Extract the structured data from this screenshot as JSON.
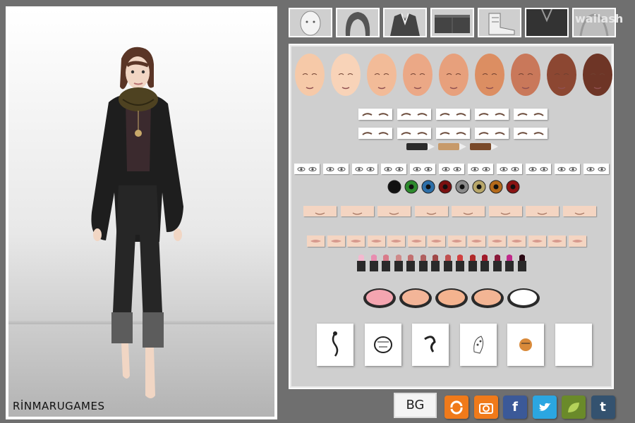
{
  "branding": {
    "studio_label": "RİNMARUGAMES",
    "watermark": "wailash"
  },
  "category_tabs": [
    {
      "icon": "face-base-icon"
    },
    {
      "icon": "hair-icon"
    },
    {
      "icon": "top-icon"
    },
    {
      "icon": "bottom-icon"
    },
    {
      "icon": "shoe-icon"
    },
    {
      "icon": "jacket-icon"
    },
    {
      "icon": "accessory-icon"
    }
  ],
  "skin_tones": [
    "#f6c9a8",
    "#f8d3b8",
    "#f2bb98",
    "#eba886",
    "#e7a07c",
    "#dc8e62",
    "#c9785a",
    "#8c4732",
    "#6e3526"
  ],
  "eye_shadow_colors": [
    "#2b2b2b",
    "#c79a6a",
    "#7a4a2a"
  ],
  "eye_colors": [
    "#111111",
    "#2d8a2d",
    "#2d6fa8",
    "#7a1010",
    "#8a8a8a",
    "#b8a76a",
    "#b56a1a",
    "#8a1414"
  ],
  "lipstick_colors": [
    "#f3b9cf",
    "#e88db0",
    "#d97b8a",
    "#cf8a8a",
    "#c27070",
    "#b06060",
    "#a04848",
    "#c05050",
    "#d04040",
    "#b02a2a",
    "#a01a2a",
    "#8a1a3a",
    "#c02a8a",
    "#2a0a14"
  ],
  "blush_colors": [
    "#f4a5b0",
    "#f3b598",
    "#f4b38f",
    "#f3b594",
    "#ffffff"
  ],
  "tattoos": [
    "scorpion-tattoo-icon",
    "tiger-face-tattoo-icon",
    "dragon-tattoo-icon",
    "leopard-tattoo-icon",
    "tiger-color-tattoo-icon",
    "empty-tattoo-slot"
  ],
  "bottom_bar": {
    "bg_label": "BG",
    "share": [
      {
        "icon": "refresh-icon",
        "color": "#f07a1a"
      },
      {
        "icon": "camera-icon",
        "color": "#f07a1a"
      },
      {
        "icon": "facebook-icon",
        "color": "#3b5998",
        "glyph": "f"
      },
      {
        "icon": "twitter-icon",
        "color": "#2ba6e1"
      },
      {
        "icon": "leaf-icon",
        "color": "#6a8a2a"
      },
      {
        "icon": "tumblr-icon",
        "color": "#34526f",
        "glyph": "t"
      }
    ]
  }
}
